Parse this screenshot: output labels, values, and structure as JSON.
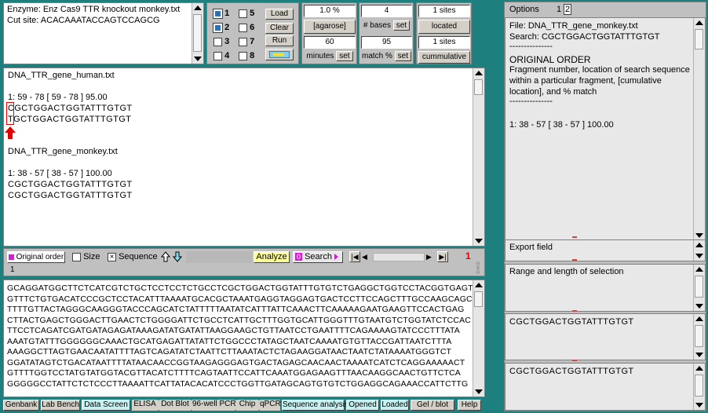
{
  "enzyme_panel": {
    "enzyme_line": "Enzyme: Enz Cas9 TTR knockout monkey.txt",
    "cut_site_line": "Cut site: ACACAAATACCAGTCCAGCG"
  },
  "lane_controls": {
    "lanes": [
      "1",
      "5",
      "2",
      "6",
      "3",
      "7",
      "4",
      "8"
    ],
    "load_label": "Load",
    "clear_label": "Clear",
    "run_label": "Run"
  },
  "params": {
    "agarose_value": "1.0 %",
    "agarose_label": "[agarose]",
    "minutes_value": "60",
    "minutes_label": "minutes",
    "bases_value": "4",
    "bases_label": "# bases",
    "match_value": "95",
    "match_label": "match %",
    "set_label": "set",
    "sites_located_value": "1 sites",
    "sites_located_label": "located",
    "sites_cumm_value": "1 sites",
    "sites_cumm_label": "cummulative"
  },
  "results": {
    "human_file": "DNA_TTR_gene_human.txt",
    "human_hit": "1: 59 - 78 [ 59 - 78 ]  95.00",
    "human_seq1": "CGCTGGACTGGTATTTGTGT",
    "human_seq2": "TGCTGGACTGGTATTTGTGT",
    "monkey_file": "DNA_TTR_gene_monkey.txt",
    "monkey_hit": "1: 38 - 57 [ 38 - 57 ]  100.00",
    "monkey_seq1": "CGCTGGACTGGTATTTGTGT",
    "monkey_seq2": "CGCTGGACTGGTATTTGTGT"
  },
  "toolbar": {
    "order_label": "Original order",
    "size_label": "Size",
    "sequence_label": "Sequence",
    "analyze_label": "Analyze",
    "search_count": "0",
    "search_label": "Search",
    "count_red": "1",
    "status_num": "1"
  },
  "sequence_lines": [
    "GCAGGATGGCTTCTCATCGTCTGCTCCTCCTCTGCCTCGCTGGACTGGTATTTGTGTCTGAGGCTGGTCCTACGGTGAGT",
    "GTTTCTGTGACATCCCGCTCCTACATTTAAAATGCACGCTAAATGAGGTAGGAGTGACTCCTTCCAGCTTTGCCAAGCAGC",
    "TTTTGTTACTAGGGCAAGGGTACCCAGCATCTATTTTTAATATCATTTATTCAAACTTCAAAAAGAATGAAGTTCCACTGAG",
    "CTTACTGAGCTGGGACTTGAACTCTGGGGATTCTGCCTCATTGCTTTGGTGCATTGGGTTTGTAATGTCTGGTATCTCCAC",
    "TTCCTCAGATCGATGATAGAGATAAAGATATGATATTAAGGAAGCTGTTAATCCTGAATTTTCAGAAAAGTATCCCTTTATA",
    "AAATGTATTTGGGGGGCAAACTGCATGAGATTATATTCTGGCCCTATAGCTAATCAAAATGTGTTACCGATTAATCTTTA",
    "AAAGGCTTAGTGAACAATATTTTAGTCAGATATCTAATTCTTAAATACTCTAGAAGGATAACTAATCTATAAAATGGGTCT",
    "GGATATAGTCTGACATAATTTTATAACAACCGGTAAGAGGGAGTGACTAGAGCAACAACTAAAATCATCTCAGGAAAAACT",
    "GTTTTGGTCCTATGTATGGTACGTTACATCTTTTCAGTAATTCCATTCAAATGGAGAAGTTTAACAAGGCAACTGTTCTCA",
    "GGGGGCCTATTCTCTCCCTTAAAATTCATTATACACATCCCTGGTTGATAGCAGTGTGTCTGGAGGCAGAAACCATTCTTG"
  ],
  "right_panel": {
    "options_label": "Options",
    "tab1": "1",
    "tab2": "2",
    "file_line": "File:  DNA_TTR_gene_monkey.txt",
    "search_line": "Search:  CGCTGGACTGGTATTTGTGT",
    "dashes": "---------------",
    "order_title": "ORIGINAL ORDER",
    "desc1": "Fragment number, location of search sequence",
    "desc2": "within a particular fragment, [cumulative",
    "desc3": "location], and % match",
    "result_line": "1: 38 - 57 [ 38 - 57 ]  100.00",
    "export_label": "Export field",
    "range_label": "Range and length of selection",
    "box1_seq": "CGCTGGACTGGTATTTGTGT",
    "box2_seq": "CGCTGGACTGGTATTTGTGT"
  },
  "bottom_tabs": [
    "Genbank",
    "Lab Bench",
    "Data Screen",
    "ELISA",
    "Dot Blot",
    "96-well PCR",
    "Chip",
    "qPCR",
    "Sequence analysis",
    "Opened",
    "Loaded",
    "Gel / blot",
    "Help"
  ],
  "colors": {
    "background": "#1e7f7f",
    "accent_red": "#e00000",
    "highlight_yellow": "#ffff99",
    "cyan_tab": "#c8f0f0"
  },
  "icons": [
    "up-arrow-icon",
    "down-arrow-icon",
    "red-arrow-icon",
    "first-icon",
    "prev-icon",
    "next-icon",
    "last-icon",
    "swap-icon"
  ]
}
